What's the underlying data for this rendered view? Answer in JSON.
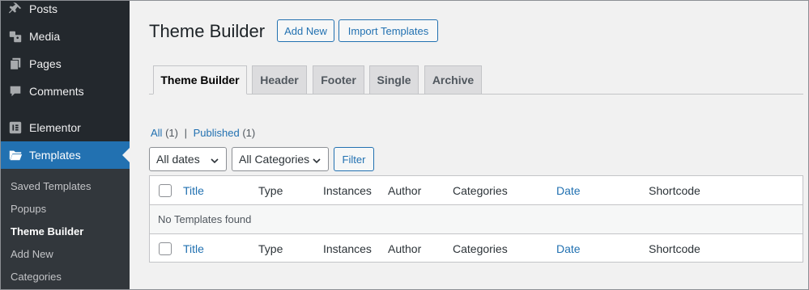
{
  "sidebar": {
    "items": [
      {
        "label": "Posts",
        "icon": "pin-icon"
      },
      {
        "label": "Media",
        "icon": "media-icon"
      },
      {
        "label": "Pages",
        "icon": "pages-icon"
      },
      {
        "label": "Comments",
        "icon": "comment-icon"
      },
      {
        "label": "Elementor",
        "icon": "elementor-icon"
      },
      {
        "label": "Templates",
        "icon": "folder-icon"
      }
    ],
    "submenu": [
      "Saved Templates",
      "Popups",
      "Theme Builder",
      "Add New",
      "Categories"
    ]
  },
  "header": {
    "title": "Theme Builder",
    "add_new": "Add New",
    "import_templates": "Import Templates"
  },
  "tabs": [
    "Theme Builder",
    "Header",
    "Footer",
    "Single",
    "Archive"
  ],
  "views": {
    "all": "All",
    "all_count": "(1)",
    "separator": "|",
    "published": "Published",
    "published_count": "(1)"
  },
  "filters": {
    "dates": "All dates",
    "categories": "All Categories",
    "filter_button": "Filter"
  },
  "table": {
    "columns": [
      "Title",
      "Type",
      "Instances",
      "Author",
      "Categories",
      "Date",
      "Shortcode"
    ],
    "empty_message": "No Templates found"
  },
  "colors": {
    "sidebar_bg": "#23282d",
    "accent": "#2271b1",
    "page_bg": "#f1f1f1"
  }
}
